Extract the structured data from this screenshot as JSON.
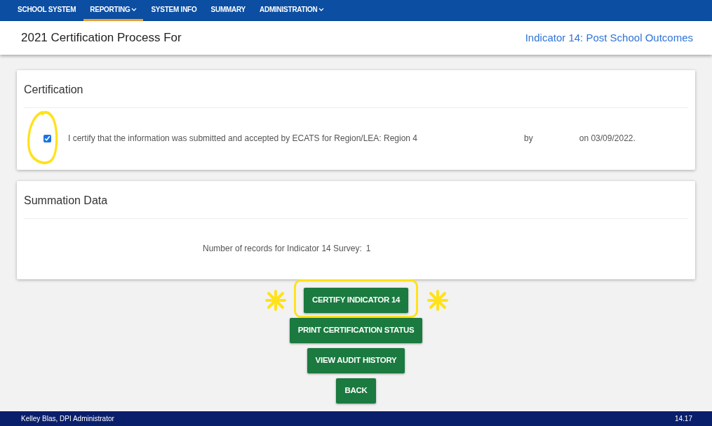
{
  "nav": [
    {
      "label": "SCHOOL SYSTEM",
      "selected": false,
      "has_menu": false
    },
    {
      "label": "REPORTING",
      "selected": true,
      "has_menu": true
    },
    {
      "label": "SYSTEM INFO",
      "selected": false,
      "has_menu": false
    },
    {
      "label": "SUMMARY",
      "selected": false,
      "has_menu": false
    },
    {
      "label": "ADMINISTRATION",
      "selected": false,
      "has_menu": true
    }
  ],
  "header": {
    "title": "2021 Certification Process For",
    "indicator": "Indicator 14: Post School Outcomes"
  },
  "certification": {
    "title": "Certification",
    "checked": true,
    "statement": "I certify that the information was submitted and accepted by ECATS for Region/LEA: Region 4",
    "by": "by",
    "date": "on 03/09/2022."
  },
  "summation": {
    "title": "Summation Data",
    "label": "Number of records for Indicator 14 Survey:",
    "value": "1"
  },
  "buttons": [
    {
      "label": "CERTIFY INDICATOR 14",
      "highlighted": true
    },
    {
      "label": "PRINT CERTIFICATION STATUS",
      "highlighted": false
    },
    {
      "label": "VIEW AUDIT HISTORY",
      "highlighted": false
    },
    {
      "label": "BACK",
      "highlighted": false
    }
  ],
  "footer": {
    "user": "Kelley Blas, DPI Administrator",
    "version": "14.17"
  }
}
